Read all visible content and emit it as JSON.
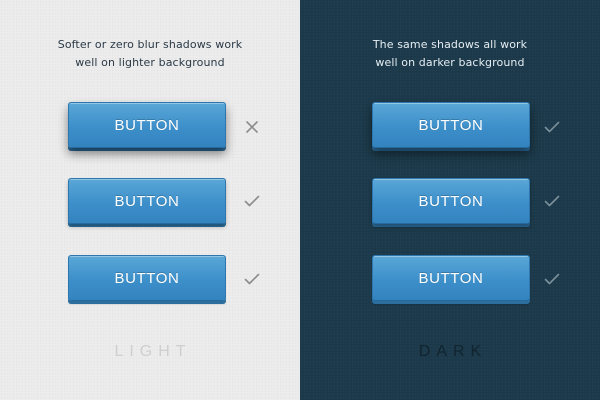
{
  "colors": {
    "light_background": "#ebebeb",
    "dark_background": "#1c3a4b",
    "button_blue": "#3d8fca",
    "mark_gray": "#8c8c8c",
    "dark_mark_gray": "#7b8f9a"
  },
  "light": {
    "caption_line1": "Softer or zero blur shadows work",
    "caption_line2": "well on lighter background",
    "buttons": [
      {
        "label": "BUTTON",
        "verdict_icon": "cross-icon"
      },
      {
        "label": "BUTTON",
        "verdict_icon": "check-icon"
      },
      {
        "label": "BUTTON",
        "verdict_icon": "check-icon"
      }
    ],
    "footer": "LIGHT"
  },
  "dark": {
    "caption_line1": "The same shadows all work",
    "caption_line2": "well on darker background",
    "buttons": [
      {
        "label": "BUTTON",
        "verdict_icon": "check-icon"
      },
      {
        "label": "BUTTON",
        "verdict_icon": "check-icon"
      },
      {
        "label": "BUTTON",
        "verdict_icon": "check-icon"
      }
    ],
    "footer": "DARK"
  }
}
